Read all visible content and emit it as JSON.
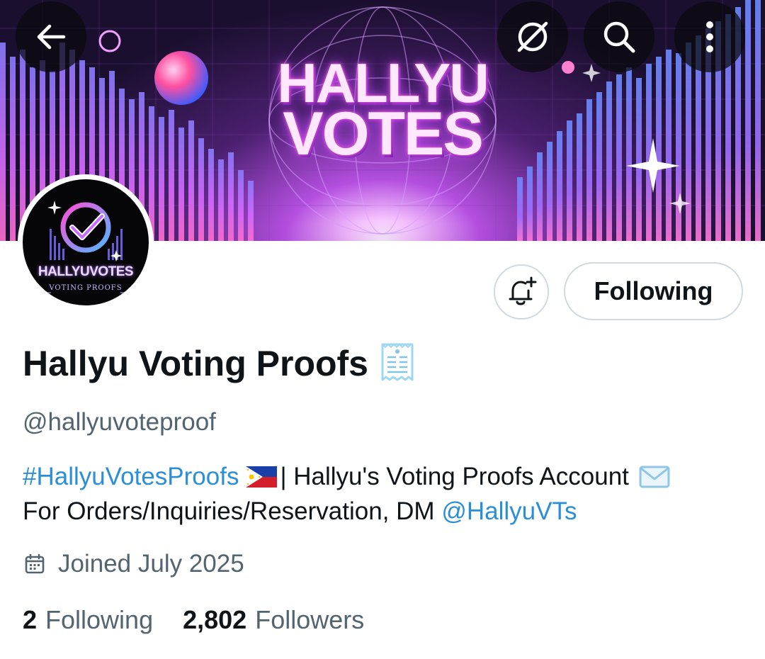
{
  "banner": {
    "title_line1": "HALLYU",
    "title_line2": "VOTES"
  },
  "topbar": {
    "back_icon": "arrow-left-icon",
    "grok_icon": "grok-icon",
    "search_icon": "search-icon",
    "more_icon": "more-vertical-icon"
  },
  "avatar": {
    "text_main": "HALLYUVOTES",
    "text_sub": "VOTING PROOFS"
  },
  "actions": {
    "notify_icon": "bell-plus-icon",
    "following_label": "Following"
  },
  "profile": {
    "display_name": "Hallyu Voting Proofs",
    "name_emoji": "receipt-icon",
    "handle": "@hallyuvoteproof",
    "bio": {
      "hashtag": "#HallyuVotesProofs",
      "flag": "philippines-flag-icon",
      "text1": "| Hallyu's Voting Proofs Account",
      "mail_icon": "envelope-icon",
      "text2": "For Orders/Inquiries/Reservation, DM",
      "mention": "@HallyuVTs"
    },
    "joined": "Joined July 2025",
    "following_count": "2",
    "following_label": "Following",
    "followers_count": "2,802",
    "followers_label": "Followers"
  },
  "colors": {
    "link": "#2b8ed8",
    "secondary_text": "#536471",
    "border": "#cfd9de"
  }
}
